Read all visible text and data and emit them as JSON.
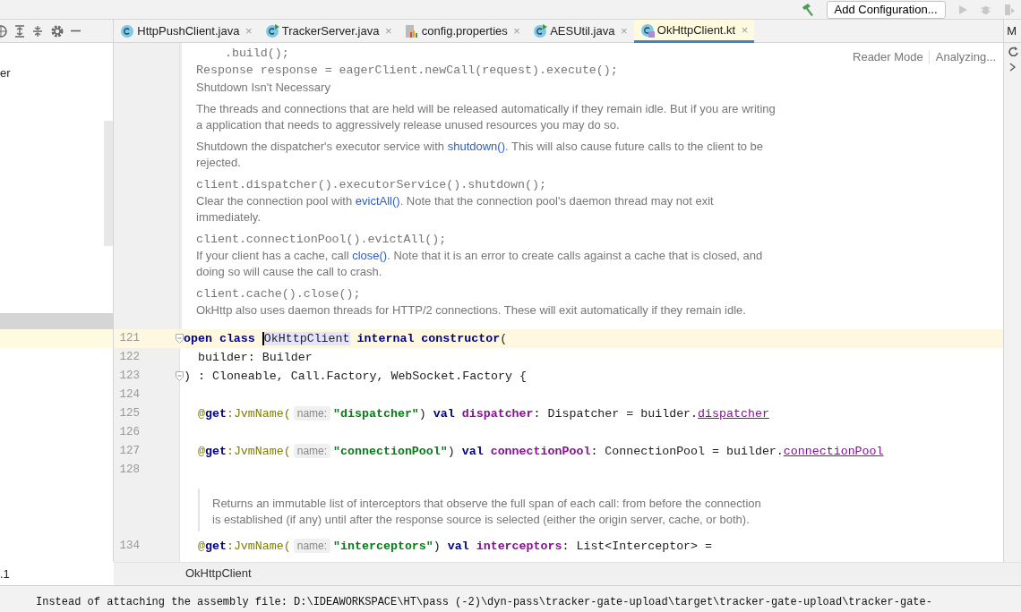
{
  "toolbar": {
    "run_config_button": "Add Configuration..."
  },
  "tabs": [
    {
      "label": "HttpPushClient.java",
      "close": "×",
      "selected": false,
      "kind": "class"
    },
    {
      "label": "TrackerServer.java",
      "close": "×",
      "selected": false,
      "kind": "runnable"
    },
    {
      "label": "config.properties",
      "close": "×",
      "selected": false,
      "kind": "properties"
    },
    {
      "label": "AESUtil.java",
      "close": "×",
      "selected": false,
      "kind": "runnable"
    },
    {
      "label": "OkHttpClient.kt",
      "close": "×",
      "selected": true,
      "kind": "kotlin"
    }
  ],
  "project_panel": {
    "items": [
      {
        "label": "er"
      },
      {
        "label": ".1"
      }
    ]
  },
  "right_strip": {
    "label": "M"
  },
  "editor": {
    "reader_mode": "Reader Mode",
    "status": "Analyzing...",
    "doc_top": [
      {
        "kind": "code",
        "text": "    .build();"
      },
      {
        "kind": "code",
        "text": "Response response = eagerClient.newCall(request).execute();"
      },
      {
        "kind": "heading",
        "text": "Shutdown Isn't Necessary"
      },
      {
        "kind": "text",
        "parts": [
          {
            "text": "The threads and connections that are held will be released automatically if they remain idle. But if you are writing a application that needs to aggressively release unused resources you may do so."
          }
        ]
      },
      {
        "kind": "text",
        "parts": [
          {
            "text": "Shutdown the dispatcher's executor service with "
          },
          {
            "text": "shutdown()",
            "link": true
          },
          {
            "text": ". This will also cause future calls to the client to be rejected."
          }
        ]
      },
      {
        "kind": "code",
        "text": "client.dispatcher().executorService().shutdown();"
      },
      {
        "kind": "text",
        "parts": [
          {
            "text": "Clear the connection pool with "
          },
          {
            "text": "evictAll()",
            "link": true
          },
          {
            "text": ". Note that the connection pool's daemon thread may not exit immediately."
          }
        ]
      },
      {
        "kind": "code",
        "text": "client.connectionPool().evictAll();"
      },
      {
        "kind": "text",
        "parts": [
          {
            "text": "If your client has a cache, call "
          },
          {
            "text": "close()",
            "link": true
          },
          {
            "text": ". Note that it is an error to create calls against a cache that is closed, and doing so will cause the call to crash."
          }
        ]
      },
      {
        "kind": "code",
        "text": "client.cache().close();"
      },
      {
        "kind": "text",
        "parts": [
          {
            "text": "OkHttp also uses daemon threads for HTTP/2 connections. These will exit automatically if they remain idle."
          }
        ]
      }
    ],
    "lines": [
      {
        "kind": "code",
        "number": "121",
        "current": true,
        "fold": true,
        "tokens": [
          {
            "kind": "kw",
            "t": "open class "
          },
          {
            "kind": "hl",
            "t": "OkHttpClient"
          },
          {
            "kind": "kw",
            "t": " internal constructor"
          },
          {
            "kind": "p",
            "t": "("
          }
        ]
      },
      {
        "kind": "code",
        "number": "122",
        "current": false,
        "fold": false,
        "tokens": [
          {
            "kind": "p",
            "t": "  builder: Builder"
          }
        ]
      },
      {
        "kind": "code",
        "number": "123",
        "current": false,
        "fold": true,
        "tokens": [
          {
            "kind": "p",
            "t": ") : Cloneable, Call.Factory, WebSocket.Factory {"
          }
        ]
      },
      {
        "kind": "code",
        "number": "124",
        "current": false,
        "fold": false
      },
      {
        "kind": "code",
        "number": "125",
        "current": false,
        "fold": false,
        "tokens": [
          {
            "kind": "an",
            "t": "  @"
          },
          {
            "kind": "kw",
            "t": "get"
          },
          {
            "kind": "an",
            "t": ":JvmName("
          },
          {
            "kind": "hint",
            "t": "name:"
          },
          {
            "kind": "str",
            "t": "\"dispatcher\""
          },
          {
            "kind": "p",
            "t": ") "
          },
          {
            "kind": "kw",
            "t": "val "
          },
          {
            "kind": "fld",
            "t": "dispatcher"
          },
          {
            "kind": "p",
            "t": ": Dispatcher = builder."
          },
          {
            "kind": "lnk",
            "t": "dispatcher"
          }
        ]
      },
      {
        "kind": "code",
        "number": "126",
        "current": false,
        "fold": false
      },
      {
        "kind": "code",
        "number": "127",
        "current": false,
        "fold": false,
        "tokens": [
          {
            "kind": "an",
            "t": "  @"
          },
          {
            "kind": "kw",
            "t": "get"
          },
          {
            "kind": "an",
            "t": ":JvmName("
          },
          {
            "kind": "hint",
            "t": "name:"
          },
          {
            "kind": "str",
            "t": "\"connectionPool\""
          },
          {
            "kind": "p",
            "t": ") "
          },
          {
            "kind": "kw",
            "t": "val "
          },
          {
            "kind": "fld",
            "t": "connectionPool"
          },
          {
            "kind": "p",
            "t": ": ConnectionPool = builder."
          },
          {
            "kind": "lnk",
            "t": "connectionPool"
          }
        ]
      },
      {
        "kind": "code",
        "number": "128",
        "current": false,
        "fold": false
      },
      {
        "kind": "doc",
        "text": "Returns an immutable list of interceptors that observe the full span of each call: from before the connection is established (if any) until after the response source is selected (either the origin server, cache, or both)."
      },
      {
        "kind": "code",
        "number": "134",
        "current": false,
        "fold": false,
        "tokens": [
          {
            "kind": "an",
            "t": "  @"
          },
          {
            "kind": "kw",
            "t": "get"
          },
          {
            "kind": "an",
            "t": ":JvmName("
          },
          {
            "kind": "hint",
            "t": "name:"
          },
          {
            "kind": "str",
            "t": "\"interceptors\""
          },
          {
            "kind": "p",
            "t": ") "
          },
          {
            "kind": "kw",
            "t": "val "
          },
          {
            "kind": "fld",
            "t": "interceptors"
          },
          {
            "kind": "p",
            "t": ": List<Interceptor> ="
          }
        ]
      }
    ],
    "breadcrumb": "OkHttpClient"
  },
  "console": {
    "text": "Instead of attaching the assembly file: D:\\IDEAWORKSPACE\\HT\\pass (-2)\\dyn-pass\\tracker-gate-upload\\target\\tracker-gate-upload\\tracker-gate-"
  }
}
